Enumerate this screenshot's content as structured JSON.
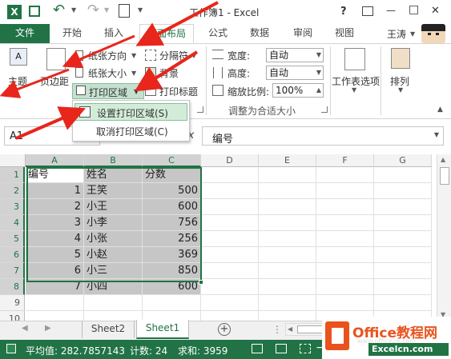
{
  "window": {
    "title": "工作簿1 - Excel",
    "help": "?",
    "minimize": "—",
    "restore": "□",
    "close": "✕"
  },
  "tabs": [
    {
      "label": "文件",
      "active": false
    },
    {
      "label": "开始",
      "active": false
    },
    {
      "label": "插入",
      "active": false
    },
    {
      "label": "页面布局",
      "active": true
    },
    {
      "label": "公式",
      "active": false
    },
    {
      "label": "数据",
      "active": false
    },
    {
      "label": "审阅",
      "active": false
    },
    {
      "label": "视图",
      "active": false
    }
  ],
  "user": {
    "name": "王涛"
  },
  "ribbon": {
    "theme_label": "主题",
    "margins_label": "页边距",
    "orientation_label": "纸张方向",
    "size_label": "纸张大小",
    "print_area_label": "打印区域",
    "breaks_label": "分隔符",
    "background_label": "背景",
    "print_titles_label": "打印标题",
    "width_label": "宽度:",
    "width_value": "自动",
    "height_label": "高度:",
    "height_value": "自动",
    "scale_label": "缩放比例:",
    "scale_value": "100%",
    "scale_group_label": "调整为合适大小",
    "sheet_options_label": "工作表选项",
    "arrange_label": "排列"
  },
  "dropdown": {
    "items": [
      {
        "label": "设置打印区域(S)",
        "highlighted": true
      },
      {
        "label": "取消打印区域(C)",
        "highlighted": false
      }
    ]
  },
  "formula": {
    "name_box": "A1",
    "fx": "fx",
    "value": "编号"
  },
  "columns": [
    "A",
    "B",
    "C",
    "D",
    "E",
    "F",
    "G"
  ],
  "rows": [
    "1",
    "2",
    "3",
    "4",
    "5",
    "6",
    "7",
    "8",
    "9",
    "10"
  ],
  "cells": [
    [
      "编号",
      "姓名",
      "分数"
    ],
    [
      "1",
      "王笑",
      "500"
    ],
    [
      "2",
      "小王",
      "600"
    ],
    [
      "3",
      "小李",
      "756"
    ],
    [
      "4",
      "小张",
      "256"
    ],
    [
      "5",
      "小赵",
      "369"
    ],
    [
      "6",
      "小三",
      "850"
    ],
    [
      "7",
      "小四",
      "600"
    ]
  ],
  "sheets": [
    {
      "label": "Sheet2",
      "active": false
    },
    {
      "label": "Sheet1",
      "active": true
    }
  ],
  "status": {
    "average": "平均值: 282.7857143",
    "count": "计数: 24",
    "sum": "求和: 3959"
  },
  "watermark": {
    "brand": "Office教程网",
    "url": "www.office26.com",
    "site": "Excelcn.com"
  },
  "colors": {
    "accent": "#217346",
    "arrow": "#e8261c",
    "highlight": "#c6c6c6",
    "menu_hover": "#d3ecd9"
  }
}
